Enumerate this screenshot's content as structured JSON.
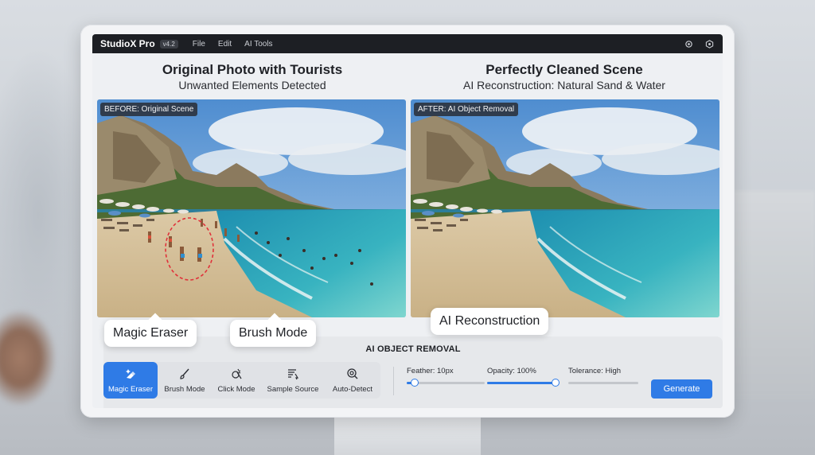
{
  "app": {
    "name": "StudioX Pro",
    "version": "v4.2",
    "menu": [
      "File",
      "Edit",
      "AI Tools"
    ],
    "icons": [
      "settings-icon",
      "settings-alt-icon"
    ]
  },
  "left_heading": {
    "title": "Original Photo with Tourists",
    "subtitle": "Unwanted Elements Detected"
  },
  "right_heading": {
    "title": "Perfectly Cleaned Scene",
    "subtitle": "AI Reconstruction: Natural Sand & Water"
  },
  "before_label": "BEFORE: Original Scene",
  "after_label": "AFTER: AI Object Removal",
  "callouts": {
    "magic_eraser": "Magic Eraser",
    "brush_mode": "Brush Mode",
    "ai_reconstruction": "AI Reconstruction"
  },
  "panel": {
    "title": "AI OBJECT REMOVAL",
    "tools": [
      {
        "label": "Magic Eraser",
        "icon": "magic-eraser-icon",
        "active": true
      },
      {
        "label": "Brush Mode",
        "icon": "brush-icon",
        "active": false
      },
      {
        "label": "Click Mode",
        "icon": "click-icon",
        "active": false
      },
      {
        "label": "Sample Source",
        "icon": "sample-source-icon",
        "active": false
      },
      {
        "label": "Auto-Detect",
        "icon": "auto-detect-icon",
        "active": false
      }
    ],
    "sliders": [
      {
        "label": "Feather: 10px",
        "value": 0.1
      },
      {
        "label": "Opacity: 100%",
        "value": 1.0
      },
      {
        "label": "Tolerance: High",
        "value": 0.0
      }
    ],
    "generate_label": "Generate"
  },
  "colors": {
    "accent": "#2f7be6",
    "menubar": "#1d1f24",
    "selection_ring": "#e0313a"
  }
}
